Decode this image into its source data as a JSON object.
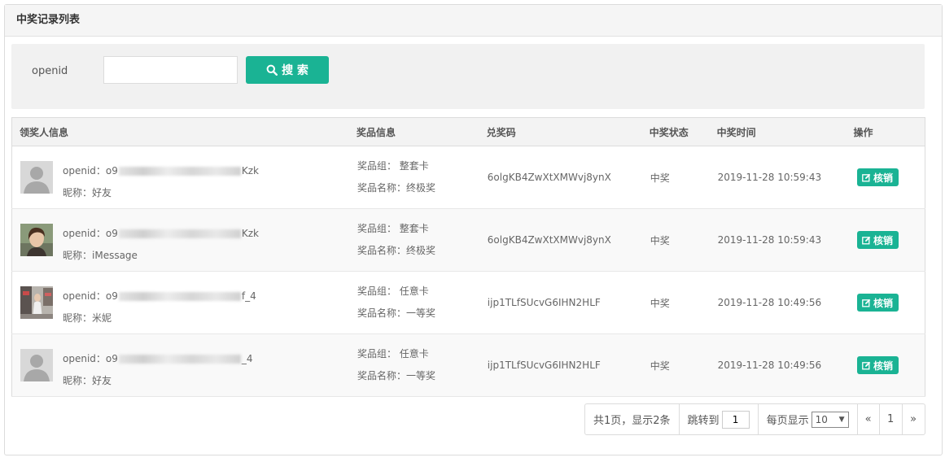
{
  "panel": {
    "title": "中奖记录列表"
  },
  "search": {
    "label": "openid",
    "value": "",
    "placeholder": "",
    "button_label": "搜 索"
  },
  "table": {
    "headers": [
      "领奖人信息",
      "奖品信息",
      "兑奖码",
      "中奖状态",
      "中奖时间",
      "操作"
    ],
    "rows": [
      {
        "openid_prefix": "openid：o9",
        "openid_suffix": "Kzk",
        "nickname": "昵称：好友",
        "avatar": "default",
        "group": "奖品组： 整套卡",
        "prize": "奖品名称：终极奖",
        "code": "6olgKB4ZwXtXMWvj8ynX",
        "status": "中奖",
        "time": "2019-11-28 10:59:43",
        "action": "核销"
      },
      {
        "openid_prefix": "openid：o9",
        "openid_suffix": "Kzk",
        "nickname": "昵称：iMessage",
        "avatar": "photo-person",
        "group": "奖品组： 整套卡",
        "prize": "奖品名称：终极奖",
        "code": "6olgKB4ZwXtXMWvj8ynX",
        "status": "中奖",
        "time": "2019-11-28 10:59:43",
        "action": "核销"
      },
      {
        "openid_prefix": "openid：o9",
        "openid_suffix": "f_4",
        "nickname": "昵称：米妮",
        "avatar": "photo-street",
        "group": "奖品组： 任意卡",
        "prize": "奖品名称：一等奖",
        "code": "ijp1TLfSUcvG6IHN2HLF",
        "status": "中奖",
        "time": "2019-11-28 10:49:56",
        "action": "核销"
      },
      {
        "openid_prefix": "openid：o9",
        "openid_suffix": "_4",
        "nickname": "昵称：好友",
        "avatar": "default",
        "group": "奖品组： 任意卡",
        "prize": "奖品名称：一等奖",
        "code": "ijp1TLfSUcvG6IHN2HLF",
        "status": "中奖",
        "time": "2019-11-28 10:49:56",
        "action": "核销"
      }
    ]
  },
  "pagination": {
    "summary": "共1页，显示2条",
    "jump_label": "跳转到",
    "jump_value": "1",
    "per_page_label": "每页显示",
    "per_page_value": "10",
    "prev": "«",
    "current_page": "1",
    "next": "»"
  },
  "colors": {
    "accent": "#1ab394",
    "header_bg": "#f5f5f5",
    "border": "#dcdcdc"
  },
  "icons": {
    "search": "search-icon",
    "edit": "edit-icon"
  }
}
